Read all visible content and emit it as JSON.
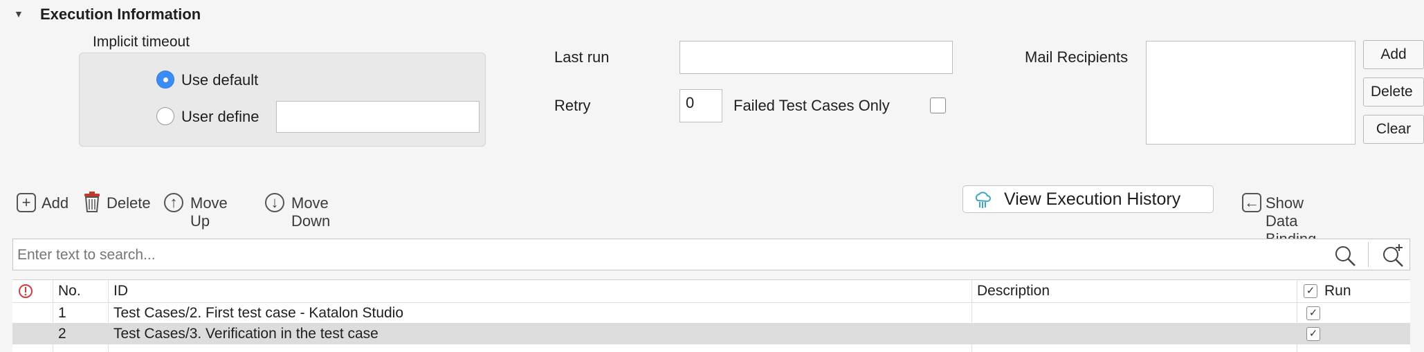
{
  "section": {
    "title": "Execution Information"
  },
  "timeout": {
    "label": "Implicit timeout",
    "options": [
      "Use default",
      "User define"
    ],
    "selected": "Use default",
    "user_define_value": ""
  },
  "last_run": {
    "label": "Last run",
    "value": ""
  },
  "retry": {
    "label": "Retry",
    "value": "0"
  },
  "failed_only": {
    "label": "Failed Test Cases Only",
    "checked": false
  },
  "mail": {
    "label": "Mail Recipients",
    "buttons": [
      "Add",
      "Delete",
      "Clear"
    ]
  },
  "toolbar": {
    "add": "Add",
    "delete": "Delete",
    "move_up": "Move Up",
    "move_down": "Move Down",
    "view_history": "View Execution History",
    "show_binding": "Show Data Binding"
  },
  "search": {
    "placeholder": "Enter text to search..."
  },
  "table": {
    "columns": [
      "No.",
      "ID",
      "Description",
      "Run"
    ],
    "rows": [
      {
        "no": "1",
        "id": "Test Cases/2. First test case - Katalon Studio",
        "description": "",
        "run": true
      },
      {
        "no": "2",
        "id": "Test Cases/3. Verification in the test case",
        "description": "",
        "run": true
      }
    ]
  },
  "colors": {
    "accent": "#3b8df5",
    "selected_row": "#dcdcdc",
    "error_icon": "#d23b3b"
  }
}
